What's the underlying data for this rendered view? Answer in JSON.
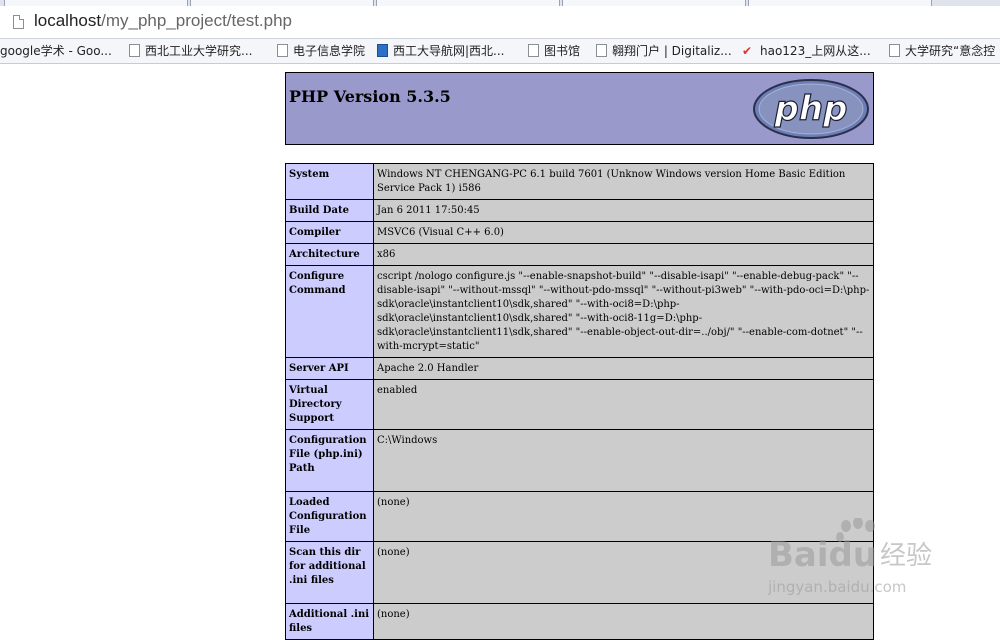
{
  "browser": {
    "url_host": "localhost",
    "url_path": "/my_php_project/test.php",
    "bookmarks": [
      {
        "label": "google学术 - Goo...",
        "icon": "none"
      },
      {
        "label": "西北工业大学研究...",
        "icon": "page-icon"
      },
      {
        "label": "电子信息学院",
        "icon": "page-icon"
      },
      {
        "label": "西工大导航网|西北...",
        "icon": "blue-nav-icon"
      },
      {
        "label": "图书馆",
        "icon": "page-icon"
      },
      {
        "label": "翱翔门户 | Digitaliz...",
        "icon": "page-icon"
      },
      {
        "label": "hao123_上网从这...",
        "icon": "hao123-icon"
      },
      {
        "label": "大学研究“意念控",
        "icon": "page-icon"
      }
    ]
  },
  "php": {
    "version_title": "PHP Version 5.3.5",
    "logo_text": "php",
    "rows": [
      {
        "key": "System",
        "value": "Windows NT CHENGANG-PC 6.1 build 7601 (Unknow Windows version Home Basic Edition Service Pack 1) i586"
      },
      {
        "key": "Build Date",
        "value": "Jan 6 2011 17:50:45"
      },
      {
        "key": "Compiler",
        "value": "MSVC6 (Visual C++ 6.0)"
      },
      {
        "key": "Architecture",
        "value": "x86"
      },
      {
        "key": "Configure Command",
        "value": "cscript /nologo configure.js \"--enable-snapshot-build\" \"--disable-isapi\" \"--enable-debug-pack\" \"--disable-isapi\" \"--without-mssql\" \"--without-pdo-mssql\" \"--without-pi3web\" \"--with-pdo-oci=D:\\php-sdk\\oracle\\instantclient10\\sdk,shared\" \"--with-oci8=D:\\php-sdk\\oracle\\instantclient10\\sdk,shared\" \"--with-oci8-11g=D:\\php-sdk\\oracle\\instantclient11\\sdk,shared\" \"--enable-object-out-dir=../obj/\" \"--enable-com-dotnet\" \"--with-mcrypt=static\""
      },
      {
        "key": "Server API",
        "value": "Apache 2.0 Handler"
      },
      {
        "key": "Virtual Directory Support",
        "value": "enabled"
      },
      {
        "key": "Configuration File (php.ini) Path",
        "value": "C:\\Windows"
      },
      {
        "key": "Loaded Configuration File",
        "value": "(none)"
      },
      {
        "key": "Scan this dir for additional .ini files",
        "value": "(none)"
      },
      {
        "key": "Additional .ini files",
        "value": "(none)"
      }
    ]
  },
  "watermark": {
    "brand": "Baidu",
    "brand_cn": "经验",
    "site": "jingyan.baidu.com"
  }
}
